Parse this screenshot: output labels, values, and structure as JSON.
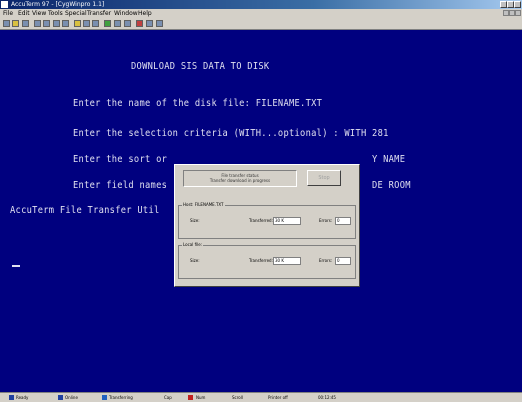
{
  "window": {
    "title": "AccuTerm 97 - [CygWinpro 1.1]"
  },
  "menu": {
    "items": [
      "File",
      "Edit",
      "View",
      "Tools",
      "Special",
      "Transfer",
      "Window",
      "Help"
    ]
  },
  "terminal": {
    "lines": [
      "DOWNLOAD SIS DATA TO DISK",
      "Enter the name of the disk file: FILENAME.TXT",
      "Enter the selection criteria (WITH...optional) : WITH 281",
      "Enter the sort or",
      "Y NAME",
      "Enter field names",
      "DE ROOM",
      "AccuTerm File Transfer Util"
    ]
  },
  "dialog": {
    "status_line1": "File transfer status",
    "status_line2": "Transfer download in progress",
    "stop_label": "Stop",
    "group1": {
      "label": "Host: FILENAME.TXT",
      "size_label": "Size:",
      "transferred_label": "Transferred:",
      "transferred_value": "30 K",
      "errors_label": "Errors:",
      "errors_value": "0"
    },
    "group2": {
      "label": "Local file:",
      "size_label": "Size:",
      "transferred_label": "Transferred:",
      "transferred_value": "30 K",
      "errors_label": "Errors:",
      "errors_value": "0"
    }
  },
  "statusbar": {
    "segments": [
      "Ready",
      "Online",
      "Transferring",
      "Cap",
      "Num",
      "Scroll",
      "Printer off",
      "00:12:45"
    ]
  }
}
